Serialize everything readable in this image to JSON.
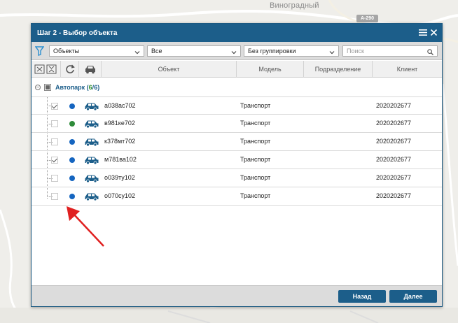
{
  "map": {
    "place_label": "Виноградный",
    "road_badge": "А-290"
  },
  "dialog": {
    "title": "Шаг 2 - Выбор объекта",
    "icons": [
      "menu-icon",
      "close-icon"
    ]
  },
  "filters": {
    "object_type": "Объекты",
    "status": "Все",
    "grouping": "Без группировки",
    "search_placeholder": "Поиск"
  },
  "table": {
    "columns": [
      "Объект",
      "Модель",
      "Подразделение",
      "Клиент"
    ],
    "group": {
      "label": "Автопарк",
      "count_selected": "6",
      "count_total": "6",
      "count_open": " (",
      "count_sep": "/",
      "count_close": ")"
    },
    "rows": [
      {
        "checked": true,
        "status_color": "#1565c0",
        "name": "а038ас702",
        "model": "Транспорт",
        "division": "",
        "client": "2020202677"
      },
      {
        "checked": false,
        "status_color": "#2e8b3a",
        "name": "в981ке702",
        "model": "Транспорт",
        "division": "",
        "client": "2020202677"
      },
      {
        "checked": false,
        "status_color": "#1565c0",
        "name": "к378мт702",
        "model": "Транспорт",
        "division": "",
        "client": "2020202677"
      },
      {
        "checked": true,
        "status_color": "#1565c0",
        "name": "м781ва102",
        "model": "Транспорт",
        "division": "",
        "client": "2020202677"
      },
      {
        "checked": false,
        "status_color": "#1565c0",
        "name": "о039ту102",
        "model": "Транспорт",
        "division": "",
        "client": "2020202677"
      },
      {
        "checked": false,
        "status_color": "#1565c0",
        "name": "о070су102",
        "model": "Транспорт",
        "division": "",
        "client": "2020202677"
      }
    ]
  },
  "footer": {
    "back_label": "Назад",
    "next_label": "Далее"
  },
  "colors": {
    "accent": "#1c5e8a",
    "arrow": "#e02020"
  }
}
